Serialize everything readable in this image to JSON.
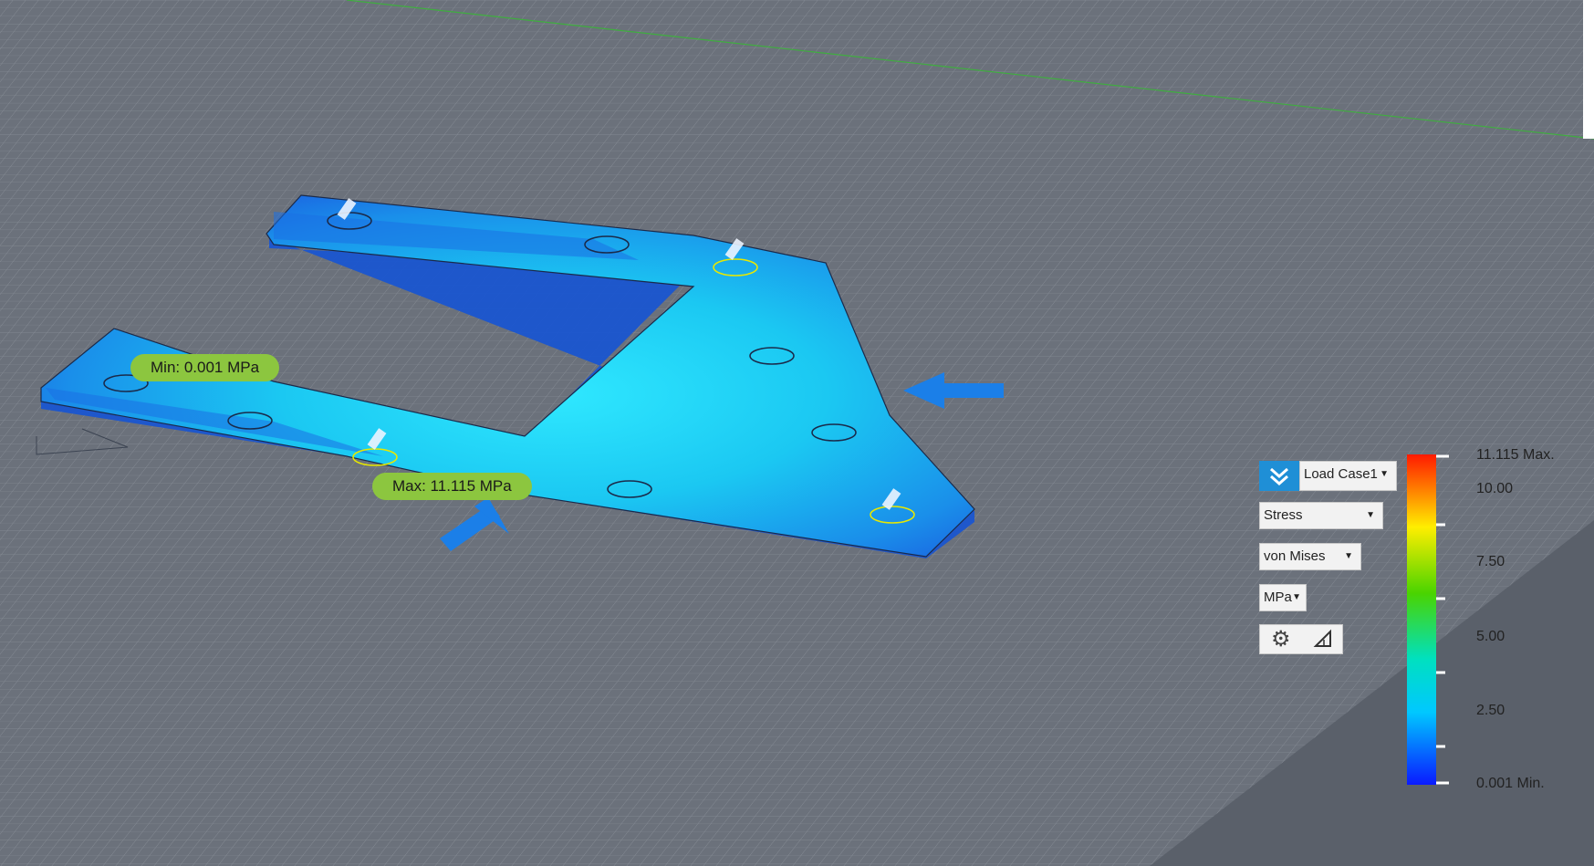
{
  "markers": {
    "min_label": "Min: 0.001 MPa",
    "max_label": "Max: 11.115 MPa"
  },
  "controls": {
    "load_case": "Load Case1",
    "result_type": "Stress",
    "component": "von Mises",
    "units": "MPa"
  },
  "icons": {
    "check": "double-chevron-down-icon",
    "settings": "gear-icon",
    "probe": "triangle-probe-icon"
  },
  "legend": {
    "max_label": "11.115 Max.",
    "ticks": [
      "10.00",
      "7.50",
      "5.00",
      "2.50"
    ],
    "min_label": "0.001 Min.",
    "min_value": 0.001,
    "max_value": 11.115
  },
  "colors": {
    "background": "#6b717b",
    "grid": "#8d939c",
    "marker": "#8cc63f",
    "accent": "#1f8fd6",
    "part": "#1fd6f0"
  }
}
